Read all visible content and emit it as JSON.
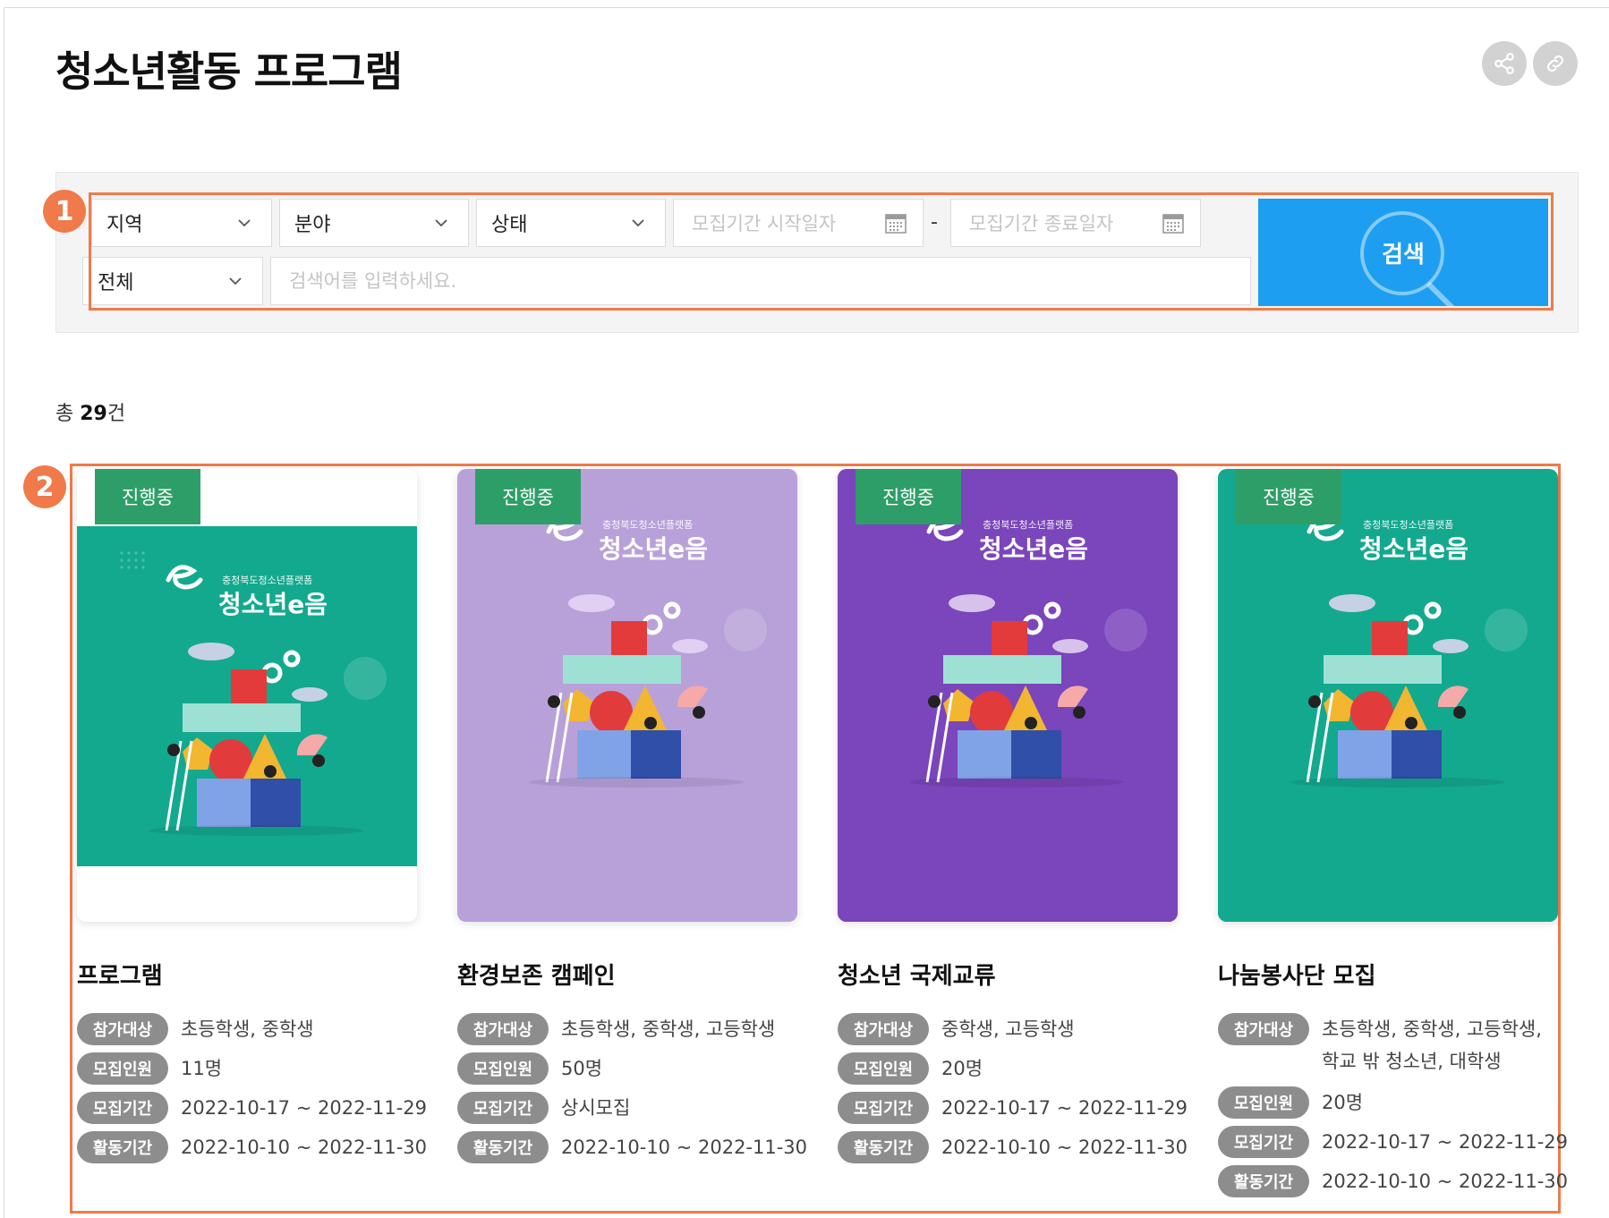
{
  "page": {
    "title": "청소년활동 프로그램"
  },
  "header_actions": [
    {
      "icon": "share-icon"
    },
    {
      "icon": "link-icon"
    }
  ],
  "annotations": {
    "one": "1",
    "two": "2"
  },
  "search": {
    "region": "지역",
    "field": "분야",
    "status": "상태",
    "start_placeholder": "모집기간 시작일자",
    "end_placeholder": "모집기간 종료일자",
    "separator": "-",
    "scope": "전체",
    "keyword_placeholder": "검색어를 입력하세요.",
    "button": "검색"
  },
  "total": {
    "prefix": "총 ",
    "count": "29",
    "suffix": "건"
  },
  "colors": {
    "accent": "#1e9ef0",
    "status_green": "#2e9e68",
    "highlight": "#f07a4a"
  },
  "cards": [
    {
      "status": "진행중",
      "poster_logo": "청소년e음",
      "poster_sub": "충청북도청소년플랫폼",
      "poster_color": "#13a98e",
      "title": "프로그램",
      "labels": [
        "참가대상",
        "모집인원",
        "모집기간",
        "활동기간"
      ],
      "target": "초등학생, 중학생",
      "target2": "",
      "recruit": "11명",
      "recruit_period": "2022-10-17 ~ 2022-11-29",
      "activity_period": "2022-10-10 ~ 2022-11-30"
    },
    {
      "status": "진행중",
      "poster_logo": "청소년e음",
      "poster_sub": "충청북도청소년플랫폼",
      "poster_color": "#b8a1d9",
      "title": "환경보존 캠페인",
      "labels": [
        "참가대상",
        "모집인원",
        "모집기간",
        "활동기간"
      ],
      "target": "초등학생, 중학생, 고등학생",
      "target2": "",
      "recruit": "50명",
      "recruit_period": "상시모집",
      "activity_period": "2022-10-10 ~ 2022-11-30"
    },
    {
      "status": "진행중",
      "poster_logo": "청소년e음",
      "poster_sub": "충청북도청소년플랫폼",
      "poster_color": "#7b45bb",
      "title": "청소년 국제교류",
      "labels": [
        "참가대상",
        "모집인원",
        "모집기간",
        "활동기간"
      ],
      "target": "중학생, 고등학생",
      "target2": "",
      "recruit": "20명",
      "recruit_period": "2022-10-17 ~ 2022-11-29",
      "activity_period": "2022-10-10 ~ 2022-11-30"
    },
    {
      "status": "진행중",
      "poster_logo": "청소년e음",
      "poster_sub": "충청북도청소년플랫폼",
      "poster_color": "#13a98e",
      "title": "나눔봉사단 모집",
      "labels": [
        "참가대상",
        "모집인원",
        "모집기간",
        "활동기간"
      ],
      "target": "초등학생, 중학생, 고등학생,",
      "target2": "학교 밖 청소년, 대학생",
      "recruit": "20명",
      "recruit_period": "2022-10-17 ~ 2022-11-29",
      "activity_period": "2022-10-10 ~ 2022-11-30"
    }
  ]
}
